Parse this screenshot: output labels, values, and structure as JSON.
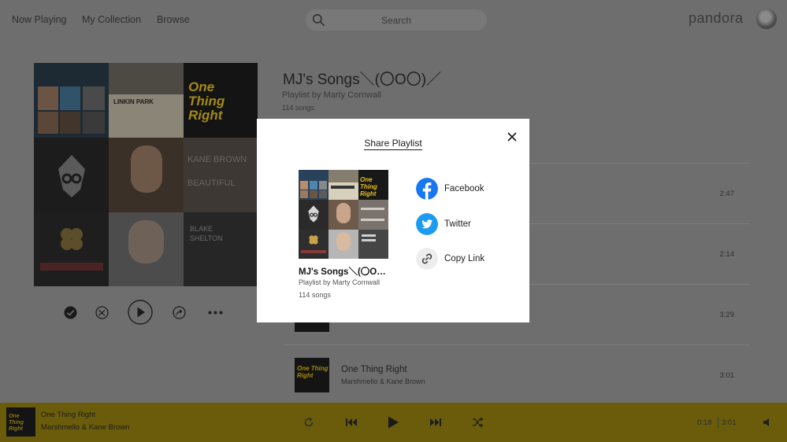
{
  "nav": {
    "now_playing": "Now Playing",
    "my_collection": "My Collection",
    "browse": "Browse",
    "search_placeholder": "Search",
    "brand": "pandora"
  },
  "playlist": {
    "title": "MJ's Songs＼(〇O〇)／",
    "byline": "Playlist by Marty Cornwall",
    "count": "114 songs"
  },
  "tracks": [
    {
      "name": "",
      "artist": "",
      "duration": "2:47"
    },
    {
      "name": "",
      "artist": "",
      "duration": "2:14"
    },
    {
      "name": "",
      "artist": "",
      "duration": "3:29"
    },
    {
      "name": "One Thing Right",
      "artist": "Marshmello & Kane Brown",
      "duration": "3:01"
    }
  ],
  "album_text": {
    "one_thing_right": "One Thing Right",
    "kane_brown": "KANE BROWN",
    "beautiful": "BEAUTIFUL",
    "blake": "BLAKE",
    "shelton": "SHELTON",
    "linkin_park": "LINKIN PARK",
    "marshmello": "MARSHMELLO"
  },
  "now_playing": {
    "song": "One Thing Right",
    "artist": "Marshmello & Kane Brown",
    "elapsed": "0:18",
    "total": "3:01"
  },
  "modal": {
    "title": "Share Playlist",
    "playlist_name": "MJ's Songs＼(〇O〇)／",
    "byline": "Playlist by Marty Cornwall",
    "count": "114 songs",
    "options": [
      {
        "label": "Facebook",
        "icon": "facebook-icon",
        "color": "#1877f2"
      },
      {
        "label": "Twitter",
        "icon": "twitter-icon",
        "color": "#1d9bf0"
      },
      {
        "label": "Copy Link",
        "icon": "link-icon",
        "color": "#ededed"
      }
    ]
  },
  "colors": {
    "overlay_bg": "#6e6e6e",
    "now_playing_bar": "#6a5c0b",
    "modal_bg": "#ffffff",
    "accent_yellow": "#e8c21a"
  }
}
